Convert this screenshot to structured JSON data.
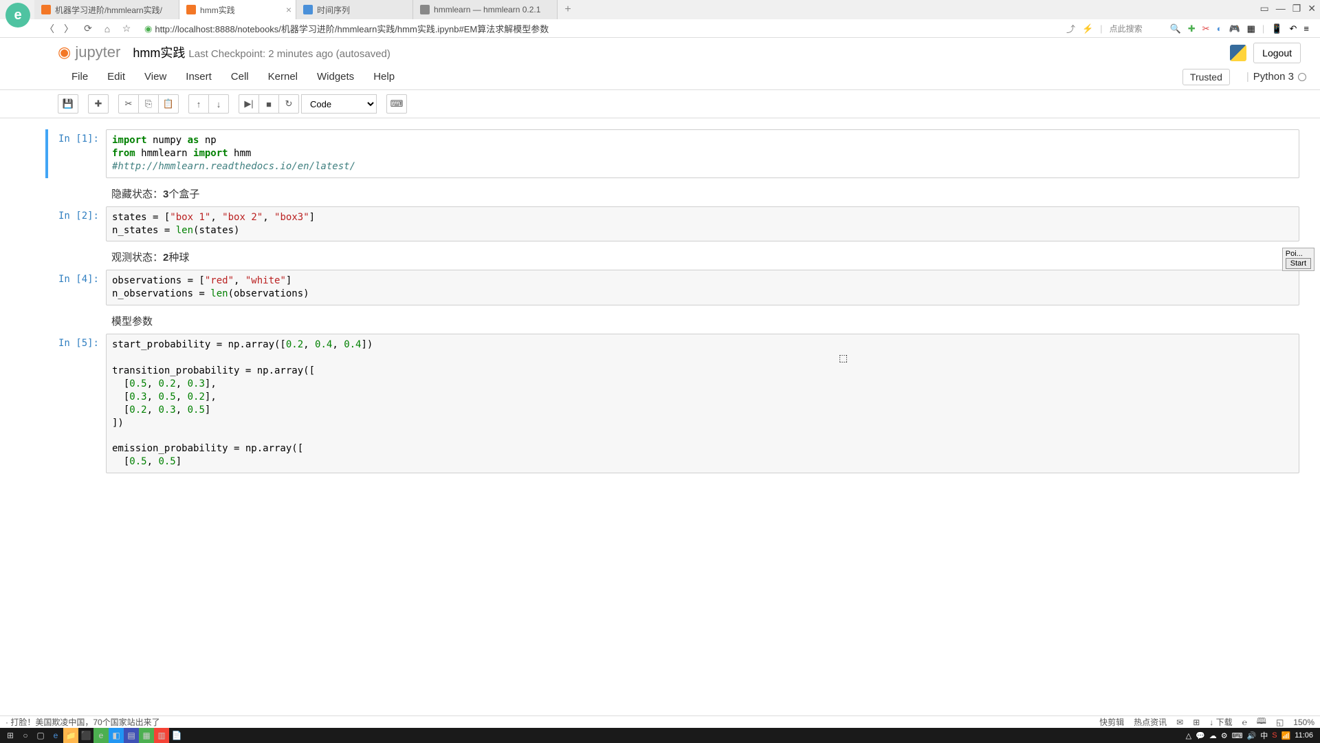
{
  "browser": {
    "tabs": [
      {
        "title": "机器学习进阶/hmmlearn实践/",
        "active": false
      },
      {
        "title": "hmm实践",
        "active": true
      },
      {
        "title": "时间序列",
        "active": false
      },
      {
        "title": "hmmlearn — hmmlearn 0.2.1",
        "active": false
      }
    ],
    "url": "http://localhost:8888/notebooks/机器学习进阶/hmmlearn实践/hmm实践.ipynb#EM算法求解模型参数",
    "search_placeholder": "点此搜索"
  },
  "jupyter": {
    "logo": "jupyter",
    "title": "hmm实践",
    "checkpoint": "Last Checkpoint: 2 minutes ago (autosaved)",
    "logout": "Logout",
    "menu": [
      "File",
      "Edit",
      "View",
      "Insert",
      "Cell",
      "Kernel",
      "Widgets",
      "Help"
    ],
    "trusted": "Trusted",
    "kernel": "Python 3",
    "cell_type": "Code"
  },
  "float": {
    "label1": "Poi...",
    "label2": "Start"
  },
  "cells": [
    {
      "prompt": "In [1]:",
      "selected": true,
      "type": "code",
      "lines": [
        {
          "kw": "import",
          "t1": " numpy ",
          "kw2": "as",
          "t2": " np"
        },
        {
          "kw": "from",
          "t1": " hmmlearn ",
          "kw2": "import",
          "t2": " hmm"
        },
        {
          "comment": "#http://hmmlearn.readthedocs.io/en/latest/"
        }
      ]
    },
    {
      "type": "md",
      "text_pre": "隐藏状态：",
      "bold": "3",
      "text_post": "个盒子"
    },
    {
      "prompt": "In [2]:",
      "type": "code",
      "raw": "states = [\"box 1\", \"box 2\", \"box3\"]\nn_states = len(states)"
    },
    {
      "type": "md",
      "text_pre": "观测状态：",
      "bold": "2",
      "text_post": "种球"
    },
    {
      "prompt": "In [4]:",
      "type": "code",
      "raw": "observations = [\"red\", \"white\"]\nn_observations = len(observations)"
    },
    {
      "type": "md",
      "text_pre": "模型参数",
      "bold": "",
      "text_post": ""
    },
    {
      "prompt": "In [5]:",
      "type": "code",
      "raw": "start_probability = np.array([0.2, 0.4, 0.4])\n\ntransition_probability = np.array([\n  [0.5, 0.2, 0.3],\n  [0.3, 0.5, 0.2],\n  [0.2, 0.3, 0.5]\n])\n\nemission_probability = np.array([\n  [0.5, 0.5]"
    }
  ],
  "news": {
    "left": "· 打脸！美国欺凌中国，70个国家站出来了",
    "r1": "快剪辑",
    "r2": "热点资讯",
    "r3": "↓ 下载",
    "r4": "150%"
  },
  "taskbar": {
    "time": "11:06"
  }
}
